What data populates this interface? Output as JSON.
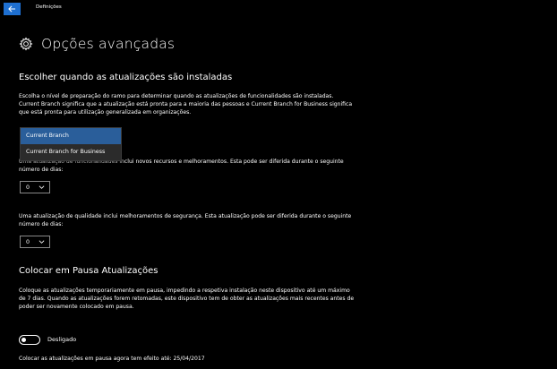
{
  "window": {
    "title": "Definições"
  },
  "page": {
    "title": "Opções avançadas"
  },
  "branch_section": {
    "title": "Escolher quando as atualizações são instaladas",
    "description_line1": "Escolha o nível de preparação do ramo para determinar quando as atualizações de funcionalidades são instaladas.",
    "description_line2": "Current Branch significa que a atualização está pronta para a maioria das pessoas e Current Branch for Business significa",
    "description_line3": "que está pronta para utilização generalizada em organizações.",
    "dropdown": {
      "options": [
        "Current Branch",
        "Current Branch for Business"
      ],
      "selected": "Current Branch"
    }
  },
  "feature_update": {
    "description_line1": "Uma atualização de funcionalidades inclui novos recursos e melhoramentos. Esta pode ser diferida durante o seguinte",
    "description_line2": "número de dias:",
    "days_value": "0"
  },
  "quality_update": {
    "description_line1": "Uma atualização de qualidade inclui melhoramentos de segurança. Esta atualização pode ser diferida durante o seguinte",
    "description_line2": "número de dias:",
    "days_value": "0"
  },
  "pause_section": {
    "title": "Colocar em Pausa Atualizações",
    "description_line1": "Coloque as atualizações temporariamente em pausa, impedindo a respetiva instalação neste dispositivo até um máximo",
    "description_line2": "de 7 dias. Quando as atualizações forem retomadas, este dispositivo tem de obter as atualizações mais recentes antes de",
    "description_line3": "poder ser novamente colocado em pausa.",
    "toggle_label": "Desligado",
    "toggle_on": false,
    "effect_note": "Colocar as atualizações em pausa agora tem efeito até: 25/04/2017"
  },
  "colors": {
    "background": "#000000",
    "accent": "#1e6fd0",
    "selected_option": "#2a5e9a"
  }
}
